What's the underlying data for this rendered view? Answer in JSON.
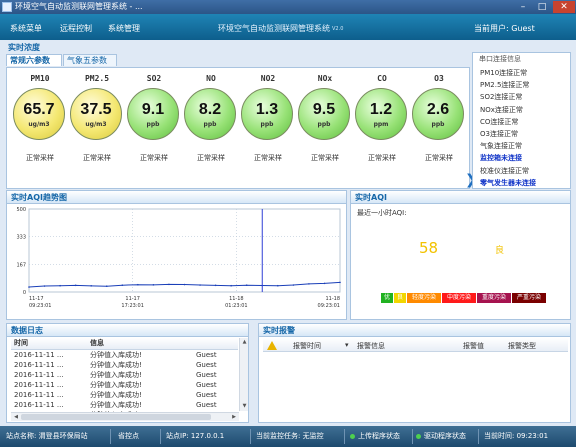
{
  "window": {
    "title": "环境空气自动监测联网管理系统 - ..."
  },
  "menubar": {
    "items": [
      "系统菜单",
      "远程控制",
      "系统管理"
    ],
    "app_title": "环境空气自动监测联网管理系统",
    "version": "V2.0",
    "current_user": "当前用户: Guest"
  },
  "realtime": {
    "section_title": "实时浓度",
    "tabs": [
      "常规六参数",
      "气象五参数"
    ],
    "gauges": [
      {
        "name": "PM10",
        "value": "65.7",
        "unit": "ug/m3",
        "status": "正常采样",
        "color": "yellow"
      },
      {
        "name": "PM2.5",
        "value": "37.5",
        "unit": "ug/m3",
        "status": "正常采样",
        "color": "yellow"
      },
      {
        "name": "SO2",
        "value": "9.1",
        "unit": "ppb",
        "status": "正常采样",
        "color": "green"
      },
      {
        "name": "NO",
        "value": "8.2",
        "unit": "ppb",
        "status": "正常采样",
        "color": "green"
      },
      {
        "name": "NO2",
        "value": "1.3",
        "unit": "ppb",
        "status": "正常采样",
        "color": "green"
      },
      {
        "name": "NOx",
        "value": "9.5",
        "unit": "ppb",
        "status": "正常采样",
        "color": "green"
      },
      {
        "name": "CO",
        "value": "1.2",
        "unit": "ppm",
        "status": "正常采样",
        "color": "green"
      },
      {
        "name": "O3",
        "value": "2.6",
        "unit": "ppb",
        "status": "正常采样",
        "color": "green"
      }
    ]
  },
  "connection": {
    "title": "串口连接信息",
    "items": [
      {
        "text": "PM10连接正常",
        "warn": false
      },
      {
        "text": "PM2.5连接正常",
        "warn": false
      },
      {
        "text": "SO2连接正常",
        "warn": false
      },
      {
        "text": "NOx连接正常",
        "warn": false
      },
      {
        "text": "CO连接正常",
        "warn": false
      },
      {
        "text": "O3连接正常",
        "warn": false
      },
      {
        "text": "气象连接正常",
        "warn": false
      },
      {
        "text": "监控箱未连接",
        "warn": true
      },
      {
        "text": "校准仪连接正常",
        "warn": false
      },
      {
        "text": "零气发生器未连接",
        "warn": true
      }
    ]
  },
  "aqi_trend": {
    "section_title": "实时AQI趋势图"
  },
  "chart_data": {
    "type": "line",
    "title": "",
    "xlabel": "",
    "ylabel": "",
    "ylim": [
      0,
      500
    ],
    "yticks": [
      "500",
      "333",
      "167",
      "0"
    ],
    "xticks": [
      {
        "date": "11-17",
        "time": "09:23:01"
      },
      {
        "date": "11-17",
        "time": "17:23:01"
      },
      {
        "date": "11-18",
        "time": "01:23:01"
      },
      {
        "date": "11-18",
        "time": "09:23:01"
      }
    ],
    "x": [
      0,
      0.05,
      0.1,
      0.15,
      0.2,
      0.25,
      0.3,
      0.35,
      0.4,
      0.45,
      0.5,
      0.55,
      0.6,
      0.65,
      0.7,
      0.75,
      0.8,
      0.85,
      0.9,
      0.95,
      1.0
    ],
    "values": [
      30,
      36,
      38,
      40,
      37,
      35,
      41,
      44,
      43,
      46,
      45,
      42,
      40,
      38,
      41,
      39,
      38,
      42,
      49,
      52,
      58
    ],
    "marker_x": 0.75,
    "colors": {
      "line": "#1a3fb8",
      "marker": "#2f3fd6",
      "grid": "#b9c7d6"
    }
  },
  "aqi_now": {
    "section_title": "实时AQI",
    "label": "最近一小时AQI:",
    "value": "58",
    "level": "良",
    "value_color": "#f2c200",
    "legend": [
      {
        "label": "优",
        "color": "#21b221"
      },
      {
        "label": "良",
        "color": "#f2d600"
      },
      {
        "label": "轻度污染",
        "color": "#ff8a00"
      },
      {
        "label": "中度污染",
        "color": "#ff1a1a"
      },
      {
        "label": "重度污染",
        "color": "#a6134f"
      },
      {
        "label": "严重污染",
        "color": "#7a0000"
      }
    ]
  },
  "log": {
    "section_title": "数据日志",
    "columns": [
      "时间",
      "信息",
      ""
    ],
    "rows": [
      [
        "2016-11-11 ...",
        "分钟值入库成功!",
        "Guest"
      ],
      [
        "2016-11-11 ...",
        "分钟值入库成功!",
        "Guest"
      ],
      [
        "2016-11-11 ...",
        "分钟值入库成功!",
        "Guest"
      ],
      [
        "2016-11-11 ...",
        "分钟值入库成功!",
        "Guest"
      ],
      [
        "2016-11-11 ...",
        "分钟值入库成功!",
        "Guest"
      ],
      [
        "2016-11-11 ...",
        "分钟值入库成功!",
        "Guest"
      ],
      [
        "2016-11-11 ...",
        "分钟值入库成功!",
        "Guest"
      ]
    ]
  },
  "alarm": {
    "section_title": "实时报警",
    "columns": [
      "报警时间",
      "报警信息",
      "报警值",
      "报警类型"
    ]
  },
  "statusbar": {
    "station_name": "站点名称: 渭登县环保局站",
    "station_type": "省控点",
    "station_ip": "站点IP: 127.0.0.1",
    "monitor_task": "当前监控任务: 无监控",
    "upload_status": "上传程序状态",
    "driver_status": "驱动程序状态",
    "current_time": "当前时间: 09:23:01"
  }
}
